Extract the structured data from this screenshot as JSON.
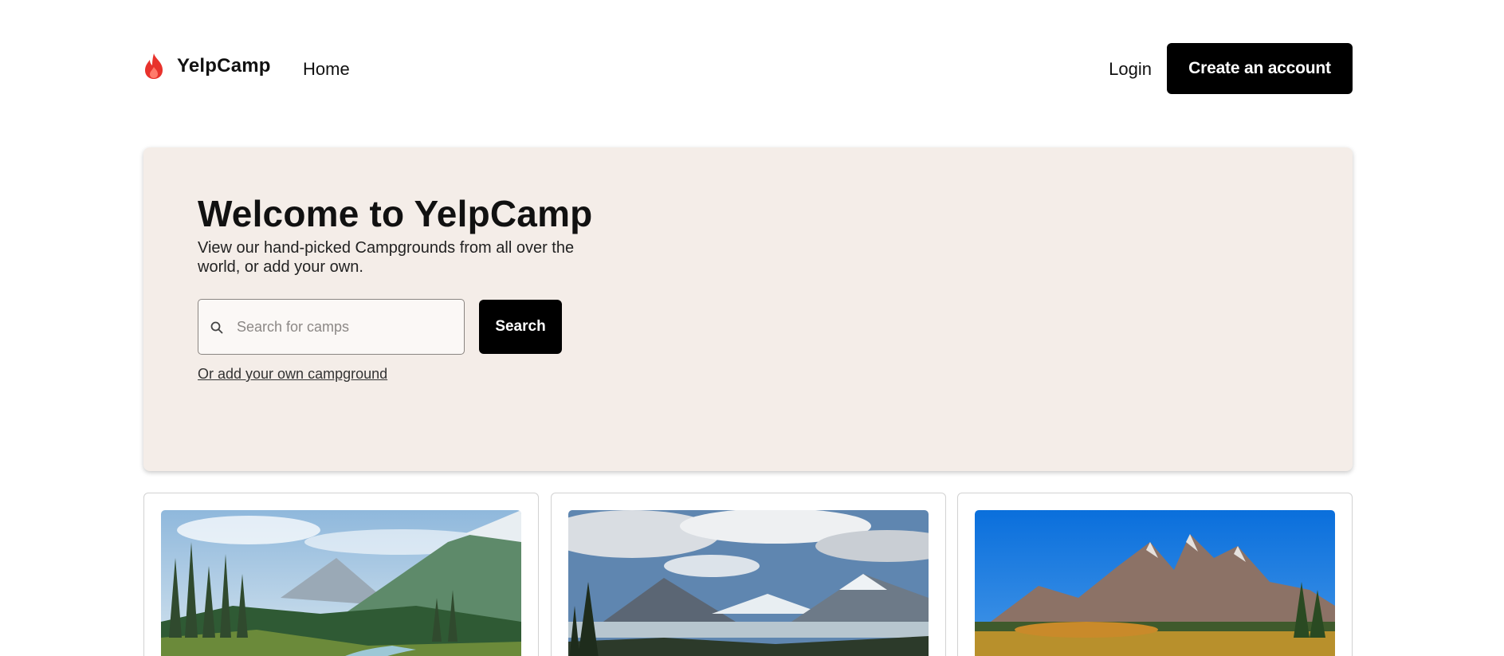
{
  "nav": {
    "brand": "YelpCamp",
    "home": "Home",
    "login": "Login",
    "create_account": "Create an account"
  },
  "hero": {
    "title": "Welcome to YelpCamp",
    "subtitle": "View our hand-picked Campgrounds from all over the world, or add your own.",
    "search_placeholder": "Search for camps",
    "search_value": "",
    "search_button": "Search",
    "add_link": "Or add your own campground"
  },
  "icons": {
    "brand": "flame-icon",
    "search": "search-icon"
  },
  "colors": {
    "brand_flame": "#e8322c",
    "hero_background": "#f4ede8",
    "button_background": "#000000"
  }
}
